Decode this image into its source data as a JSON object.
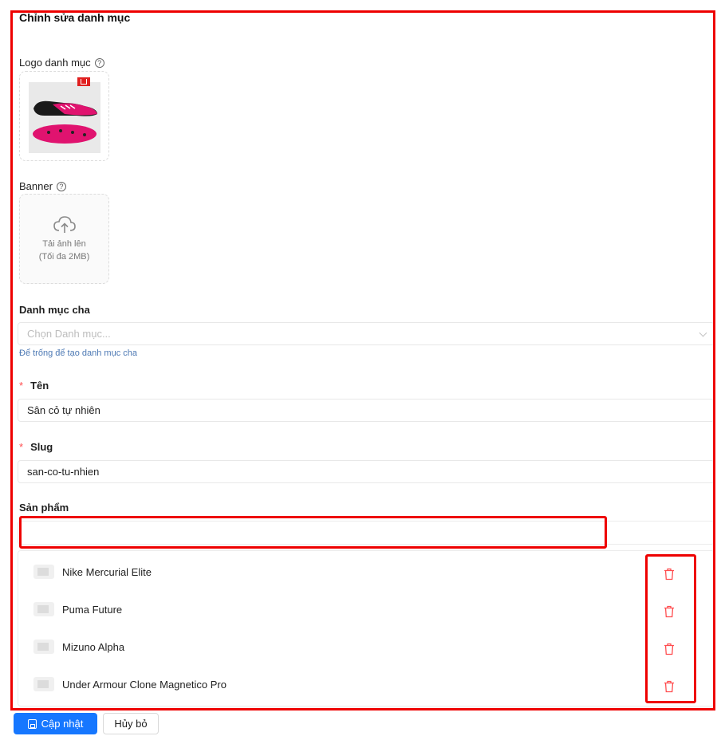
{
  "form": {
    "title": "Chỉnh sửa danh mục",
    "logo": {
      "label": "Logo danh mục"
    },
    "banner": {
      "label": "Banner",
      "upload_line1": "Tải ảnh lên",
      "upload_line2": "(Tối đa 2MB)"
    },
    "parent": {
      "label": "Danh mục cha",
      "placeholder": "Chọn Danh mục...",
      "hint": "Để trống để tạo danh mục cha"
    },
    "name": {
      "label": "Tên",
      "value": "Sân cỏ tự nhiên"
    },
    "slug": {
      "label": "Slug",
      "value": "san-co-tu-nhien"
    },
    "products": {
      "label": "Sản phẩm",
      "items": [
        {
          "name": "Nike Mercurial Elite"
        },
        {
          "name": "Puma Future"
        },
        {
          "name": "Mizuno Alpha"
        },
        {
          "name": "Under Armour Clone Magnetico Pro"
        }
      ]
    }
  },
  "footer": {
    "update_label": "Cập nhật",
    "cancel_label": "Hủy bỏ"
  },
  "colors": {
    "primary": "#1677ff",
    "danger": "#ff4d4f",
    "annotation": "#ee0000"
  },
  "icons": {
    "help": "question-circle-icon",
    "upload": "cloud-upload-icon",
    "delete": "trash-icon",
    "save": "save-icon"
  }
}
